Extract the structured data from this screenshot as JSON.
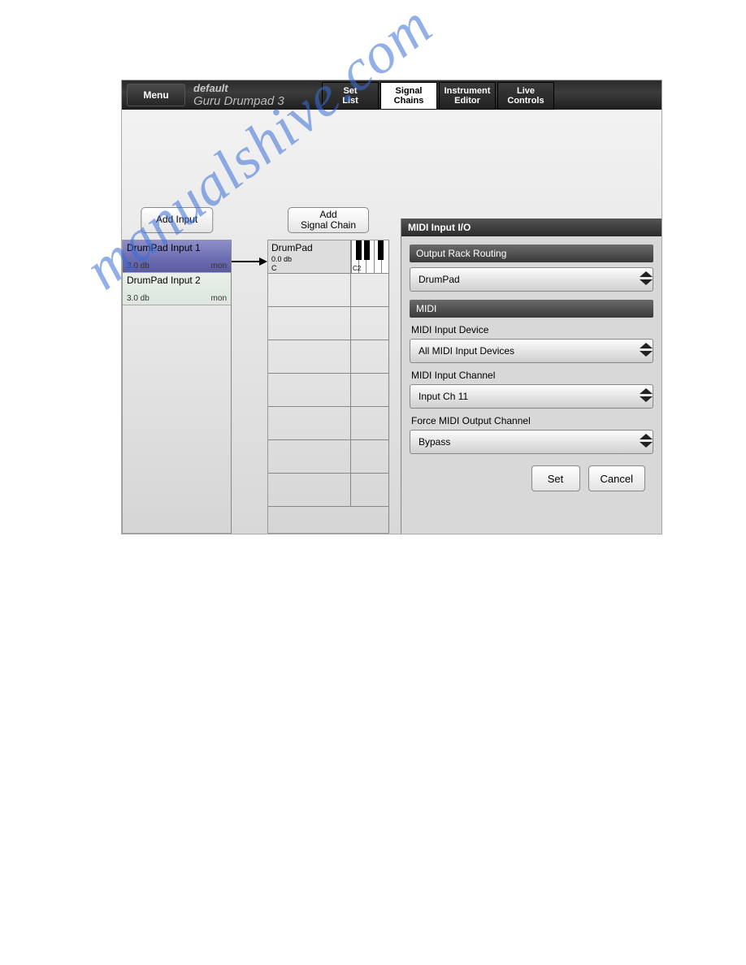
{
  "topbar": {
    "menu": "Menu",
    "title_default": "default",
    "title_sub": "Guru Drumpad 3",
    "tabs": [
      "Set\nList",
      "Signal\nChains",
      "Instrument\nEditor",
      "Live\nControls"
    ],
    "active_tab_index": 1
  },
  "inputs": {
    "add_label": "Add Input",
    "items": [
      {
        "name": "DrumPad Input 1",
        "db": "3.0 db",
        "mon": "mon",
        "selected": true
      },
      {
        "name": "DrumPad Input 2",
        "db": "3.0 db",
        "mon": "mon",
        "selected": false
      }
    ]
  },
  "chains": {
    "add_label": "Add\nSignal Chain",
    "first": {
      "name": "DrumPad",
      "db": "0.0 db",
      "note": "C",
      "kbd_label": "C2"
    },
    "empty_rows": 7
  },
  "panel": {
    "header": "MIDI Input I/O",
    "sec_routing": "Output Rack Routing",
    "dd_routing": "DrumPad",
    "sec_midi": "MIDI",
    "lbl_device": "MIDI Input Device",
    "dd_device": "All MIDI Input Devices",
    "lbl_channel": "MIDI Input Channel",
    "dd_channel": "Input Ch 11",
    "lbl_force": "Force MIDI Output Channel",
    "dd_force": "Bypass",
    "btn_set": "Set",
    "btn_cancel": "Cancel"
  },
  "watermark": "manualshive.com"
}
